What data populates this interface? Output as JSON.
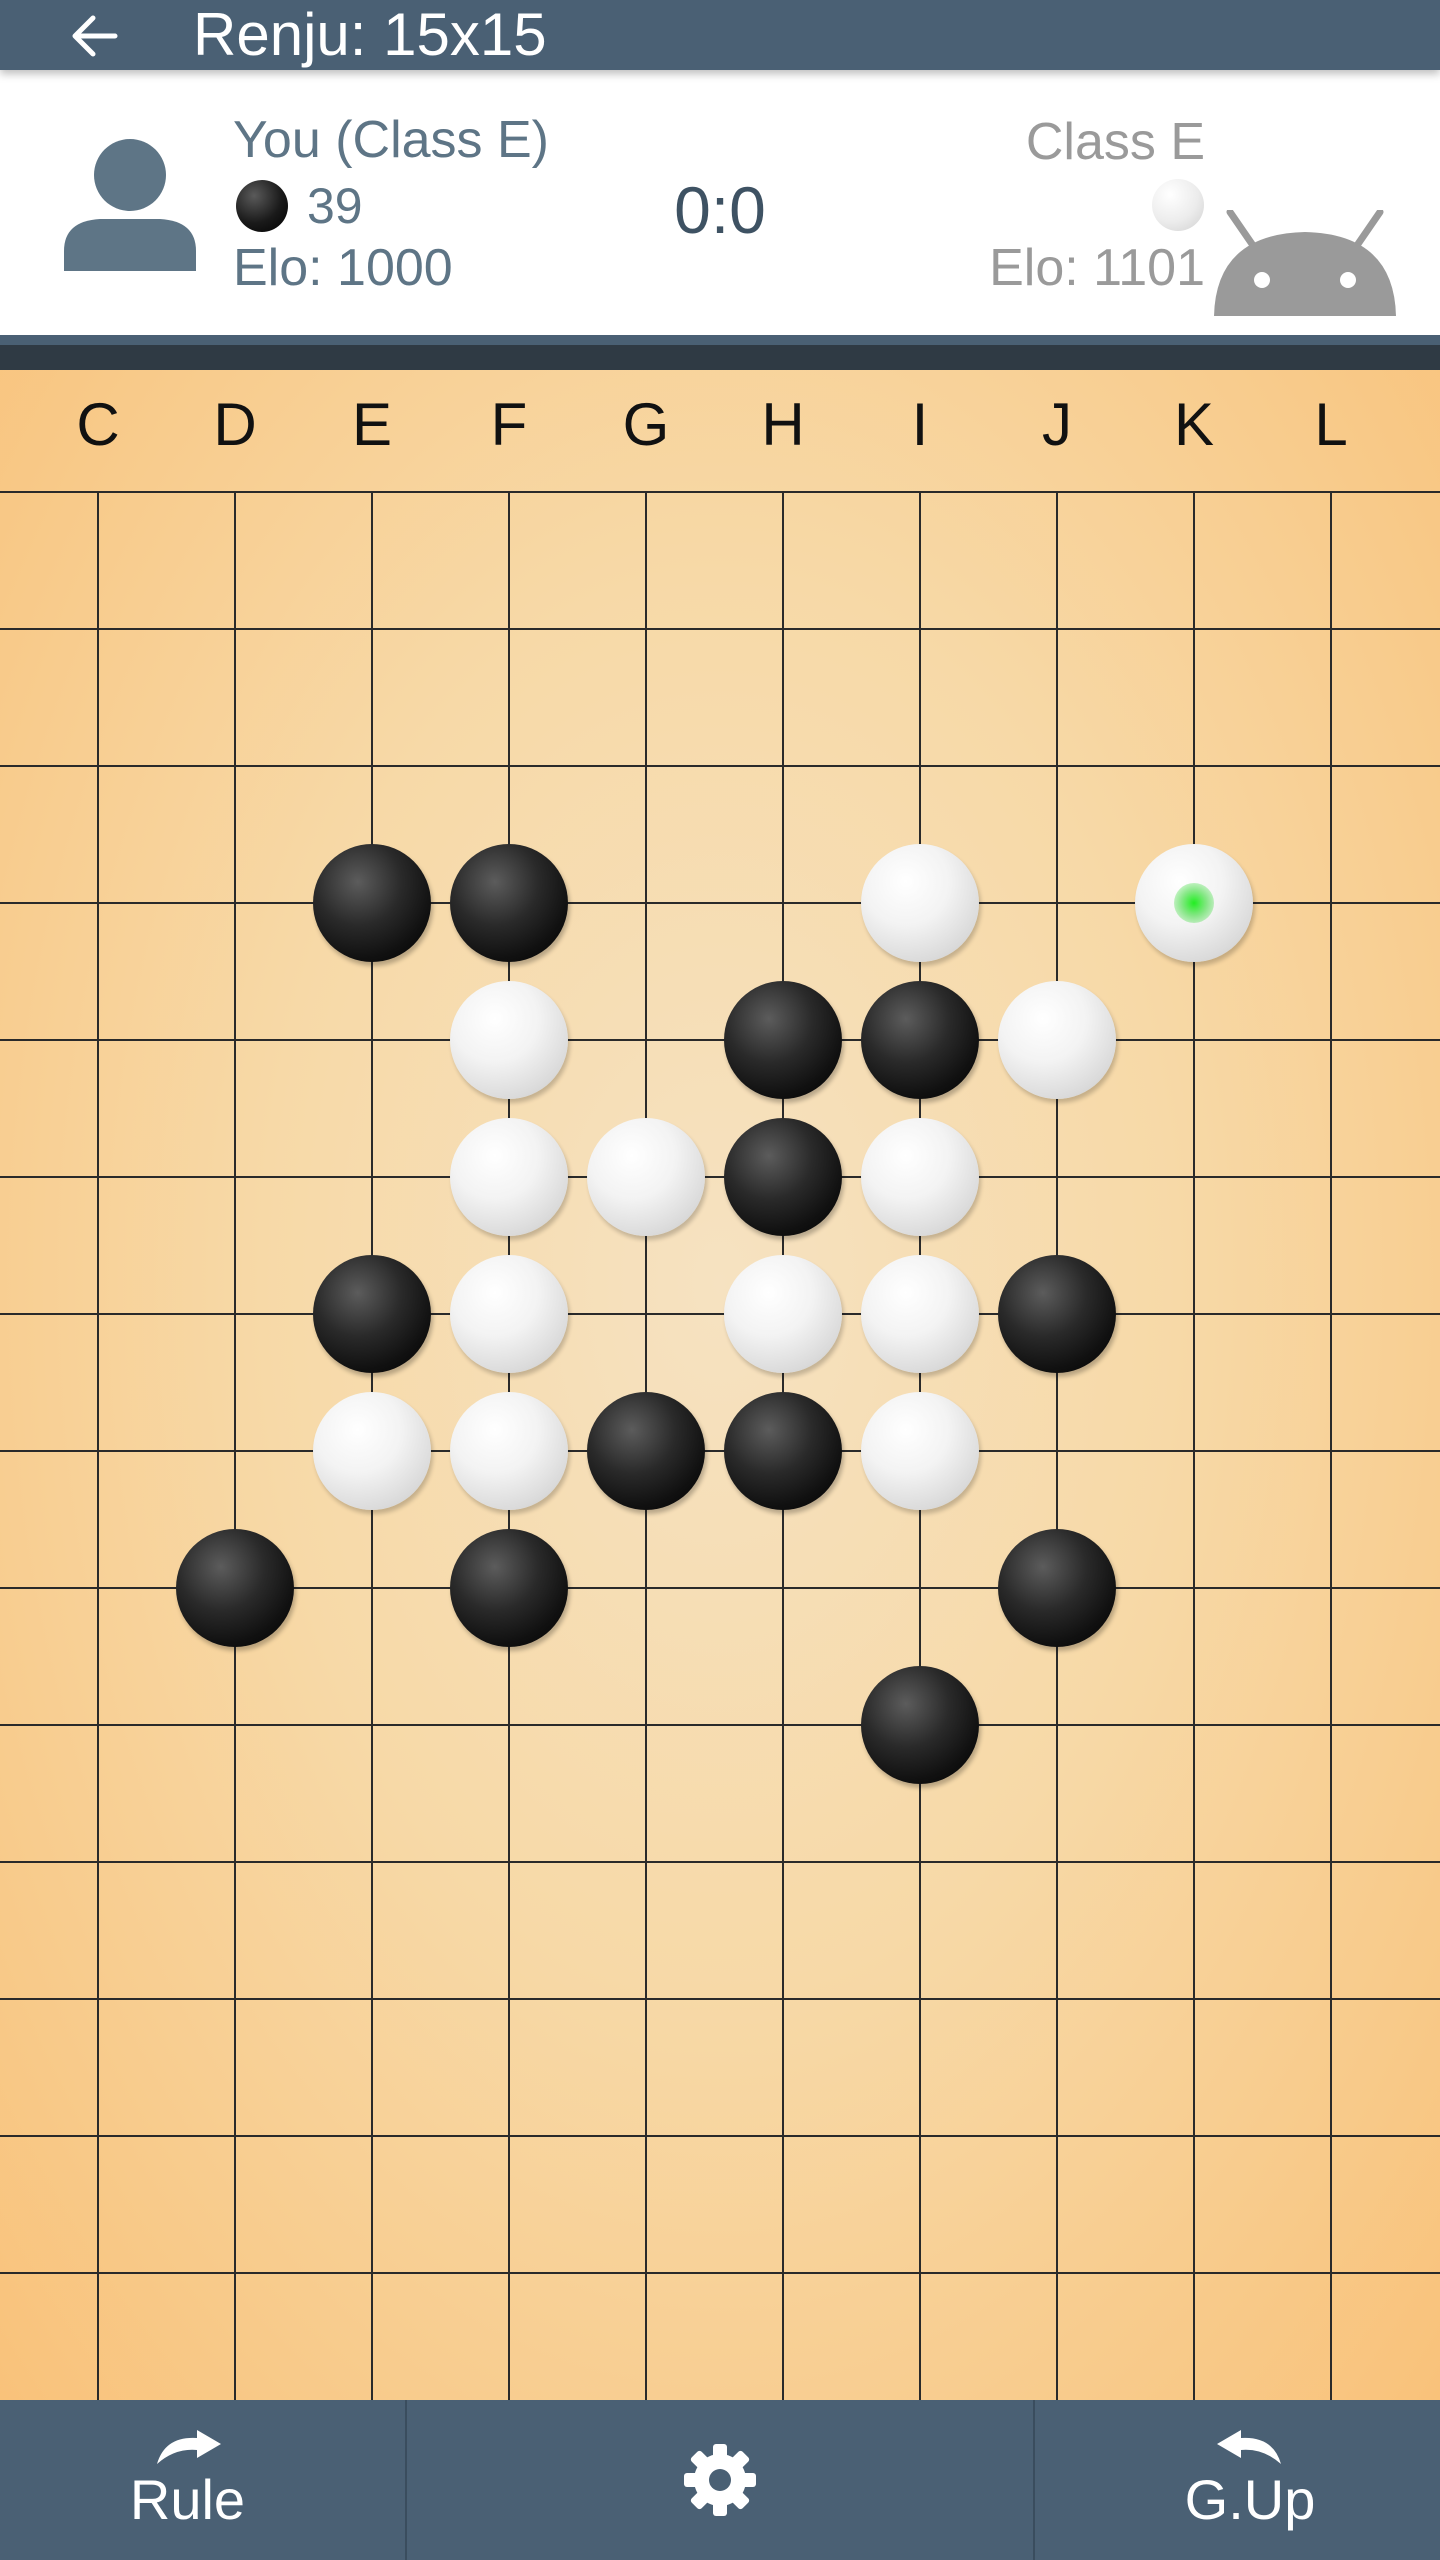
{
  "appbar": {
    "title": "Renju: 15x15",
    "back_icon": "arrow-left-icon"
  },
  "player": {
    "name": "You (Class E)",
    "stone_color": "black",
    "stone_count": "39",
    "elo": "Elo: 1000"
  },
  "score": "0:0",
  "opponent": {
    "name": "Class E",
    "stone_color": "white",
    "elo": "Elo: 1101"
  },
  "board": {
    "columns": [
      "C",
      "D",
      "E",
      "F",
      "G",
      "H",
      "I",
      "J",
      "K",
      "L"
    ],
    "last_move": {
      "col": "K",
      "row": 3
    },
    "stones": [
      {
        "col": "E",
        "row": 3,
        "color": "black"
      },
      {
        "col": "F",
        "row": 3,
        "color": "black"
      },
      {
        "col": "I",
        "row": 3,
        "color": "white"
      },
      {
        "col": "K",
        "row": 3,
        "color": "white"
      },
      {
        "col": "F",
        "row": 4,
        "color": "white"
      },
      {
        "col": "H",
        "row": 4,
        "color": "black"
      },
      {
        "col": "I",
        "row": 4,
        "color": "black"
      },
      {
        "col": "J",
        "row": 4,
        "color": "white"
      },
      {
        "col": "F",
        "row": 5,
        "color": "white"
      },
      {
        "col": "G",
        "row": 5,
        "color": "white"
      },
      {
        "col": "H",
        "row": 5,
        "color": "black"
      },
      {
        "col": "I",
        "row": 5,
        "color": "white"
      },
      {
        "col": "E",
        "row": 6,
        "color": "black"
      },
      {
        "col": "F",
        "row": 6,
        "color": "white"
      },
      {
        "col": "H",
        "row": 6,
        "color": "white"
      },
      {
        "col": "I",
        "row": 6,
        "color": "white"
      },
      {
        "col": "J",
        "row": 6,
        "color": "black"
      },
      {
        "col": "E",
        "row": 7,
        "color": "white"
      },
      {
        "col": "F",
        "row": 7,
        "color": "white"
      },
      {
        "col": "G",
        "row": 7,
        "color": "black"
      },
      {
        "col": "H",
        "row": 7,
        "color": "black"
      },
      {
        "col": "I",
        "row": 7,
        "color": "white"
      },
      {
        "col": "D",
        "row": 8,
        "color": "black"
      },
      {
        "col": "F",
        "row": 8,
        "color": "black"
      },
      {
        "col": "J",
        "row": 8,
        "color": "black"
      },
      {
        "col": "I",
        "row": 9,
        "color": "black"
      }
    ]
  },
  "bottom_bar": {
    "rule_label": "Rule",
    "rule_icon": "redo-icon",
    "settings_icon": "gear-icon",
    "giveup_label": "G.Up",
    "giveup_icon": "undo-icon"
  },
  "colors": {
    "appbar": "#4a6074",
    "text_primary": "#5e7586",
    "text_secondary": "#9a9a9a",
    "board_center": "#f6e2c1",
    "board_edge": "#f9c27a"
  }
}
